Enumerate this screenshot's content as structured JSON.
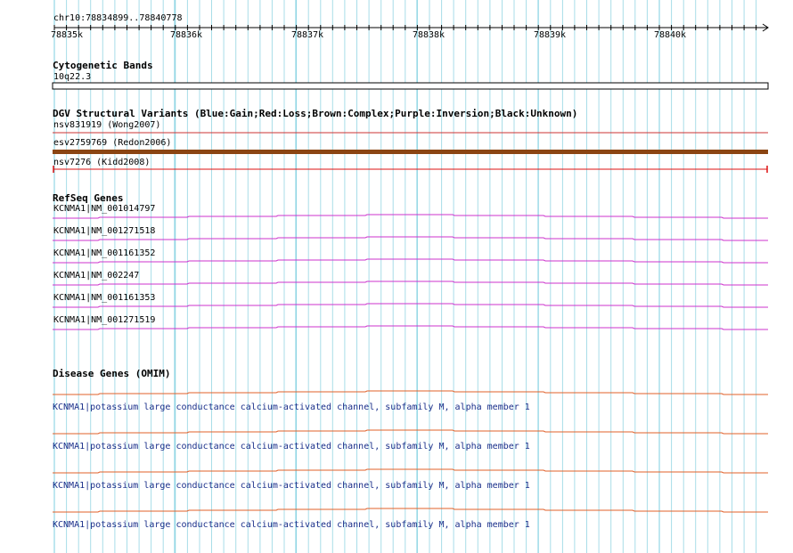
{
  "coords": {
    "text": "chr10:78834899..78840778"
  },
  "ruler": {
    "ticks": [
      "78835k",
      "78836k",
      "78837k",
      "78838k",
      "78839k",
      "78840k"
    ]
  },
  "cytobands": {
    "title": "Cytogenetic Bands",
    "band": "10q22.3"
  },
  "dgv": {
    "title": "DGV Structural Variants (Blue:Gain;Red:Loss;Brown:Complex;Purple:Inversion;Black:Unknown)",
    "items": [
      {
        "label": "nsv831919 (Wong2007)",
        "color": "#cc3333"
      },
      {
        "label": "esv2759769 (Redon2006)",
        "color": "#8b4513"
      },
      {
        "label": "nsv7276 (Kidd2008)",
        "color": "#dd1111"
      }
    ]
  },
  "refseq": {
    "title": "RefSeq Genes",
    "color": "#cc33cc",
    "genes": [
      "KCNMA1|NM_001014797",
      "KCNMA1|NM_001271518",
      "KCNMA1|NM_001161352",
      "KCNMA1|NM_002247",
      "KCNMA1|NM_001161353",
      "KCNMA1|NM_001271519"
    ]
  },
  "omim": {
    "title": "Disease Genes (OMIM)",
    "color": "#e0602a",
    "text_color": "#1a2f8a",
    "genes": [
      "KCNMA1|potassium large conductance calcium-activated channel, subfamily M, alpha member 1",
      "KCNMA1|potassium large conductance calcium-activated channel, subfamily M, alpha member 1",
      "KCNMA1|potassium large conductance calcium-activated channel, subfamily M, alpha member 1",
      "KCNMA1|potassium large conductance calcium-activated channel, subfamily M, alpha member 1"
    ]
  },
  "grid_color": "#a8dde8"
}
